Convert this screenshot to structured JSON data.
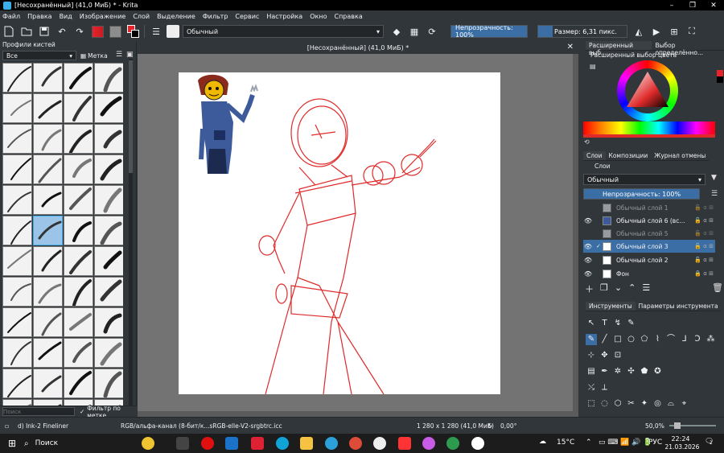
{
  "window": {
    "title": "[Несохранённый]  (41,0 МиБ)  * - Krita",
    "controls": [
      "–",
      "❐",
      "✕"
    ]
  },
  "menu": [
    "Файл",
    "Правка",
    "Вид",
    "Изображение",
    "Слой",
    "Выделение",
    "Фильтр",
    "Сервис",
    "Настройка",
    "Окно",
    "Справка"
  ],
  "toolbar": {
    "blend_mode": "Обычный",
    "opacity": "Непрозрачность: 100%",
    "size": "Размер: 6,31 пикс."
  },
  "brush_presets": {
    "title": "Профили кистей",
    "filter": "Все",
    "tag": "Метка",
    "search_placeholder": "Поиск",
    "filter_by_tag": "Фильтр по метке",
    "count": 48,
    "selected_index": 21
  },
  "document": {
    "tab_title": "[Несохранённый]  (41,0 МиБ) *",
    "close": "✕"
  },
  "color_dock": {
    "tabs": [
      "Расширенный выб...",
      "Выбор определённо..."
    ],
    "title": "Расширенный выбор цвета",
    "fg_color": "#e8232a",
    "bg_color": "#000000"
  },
  "layers_dock": {
    "tabs": [
      "Слои",
      "Композиции",
      "Журнал отмены"
    ],
    "title": "Слои",
    "blend_mode": "Обычный",
    "opacity": "Непрозрачность:  100%",
    "layers": [
      {
        "name": "Обычный слой 1",
        "visible": false,
        "selected": false,
        "faded": true
      },
      {
        "name": "Обычный слой 6 (вс...",
        "visible": true,
        "selected": false,
        "faded": false
      },
      {
        "name": "Обычный слой 5",
        "visible": false,
        "selected": false,
        "faded": true
      },
      {
        "name": "Обычный слой 3",
        "visible": true,
        "selected": true,
        "faded": false
      },
      {
        "name": "Обычный слой 2",
        "visible": true,
        "selected": false,
        "faded": false
      },
      {
        "name": "Фон",
        "visible": true,
        "selected": false,
        "faded": false
      }
    ]
  },
  "tools_dock": {
    "tabs": [
      "Инструменты",
      "Параметры инструмента"
    ]
  },
  "status": {
    "brush": "d) Ink-2 Fineliner",
    "colorspace": "RGB/альфа-канал (8-бит/к...sRGB-elle-V2-srgbtrc.icc",
    "dimensions": "1 280 x 1 280 (41,0 МиБ)",
    "rotation": "0,00°",
    "zoom": "50,0%"
  },
  "taskbar": {
    "search": "Поиск",
    "weather": "15°C",
    "lang": "РУС",
    "time": "22:24",
    "date": "21.03.2026",
    "notifications": "2"
  }
}
